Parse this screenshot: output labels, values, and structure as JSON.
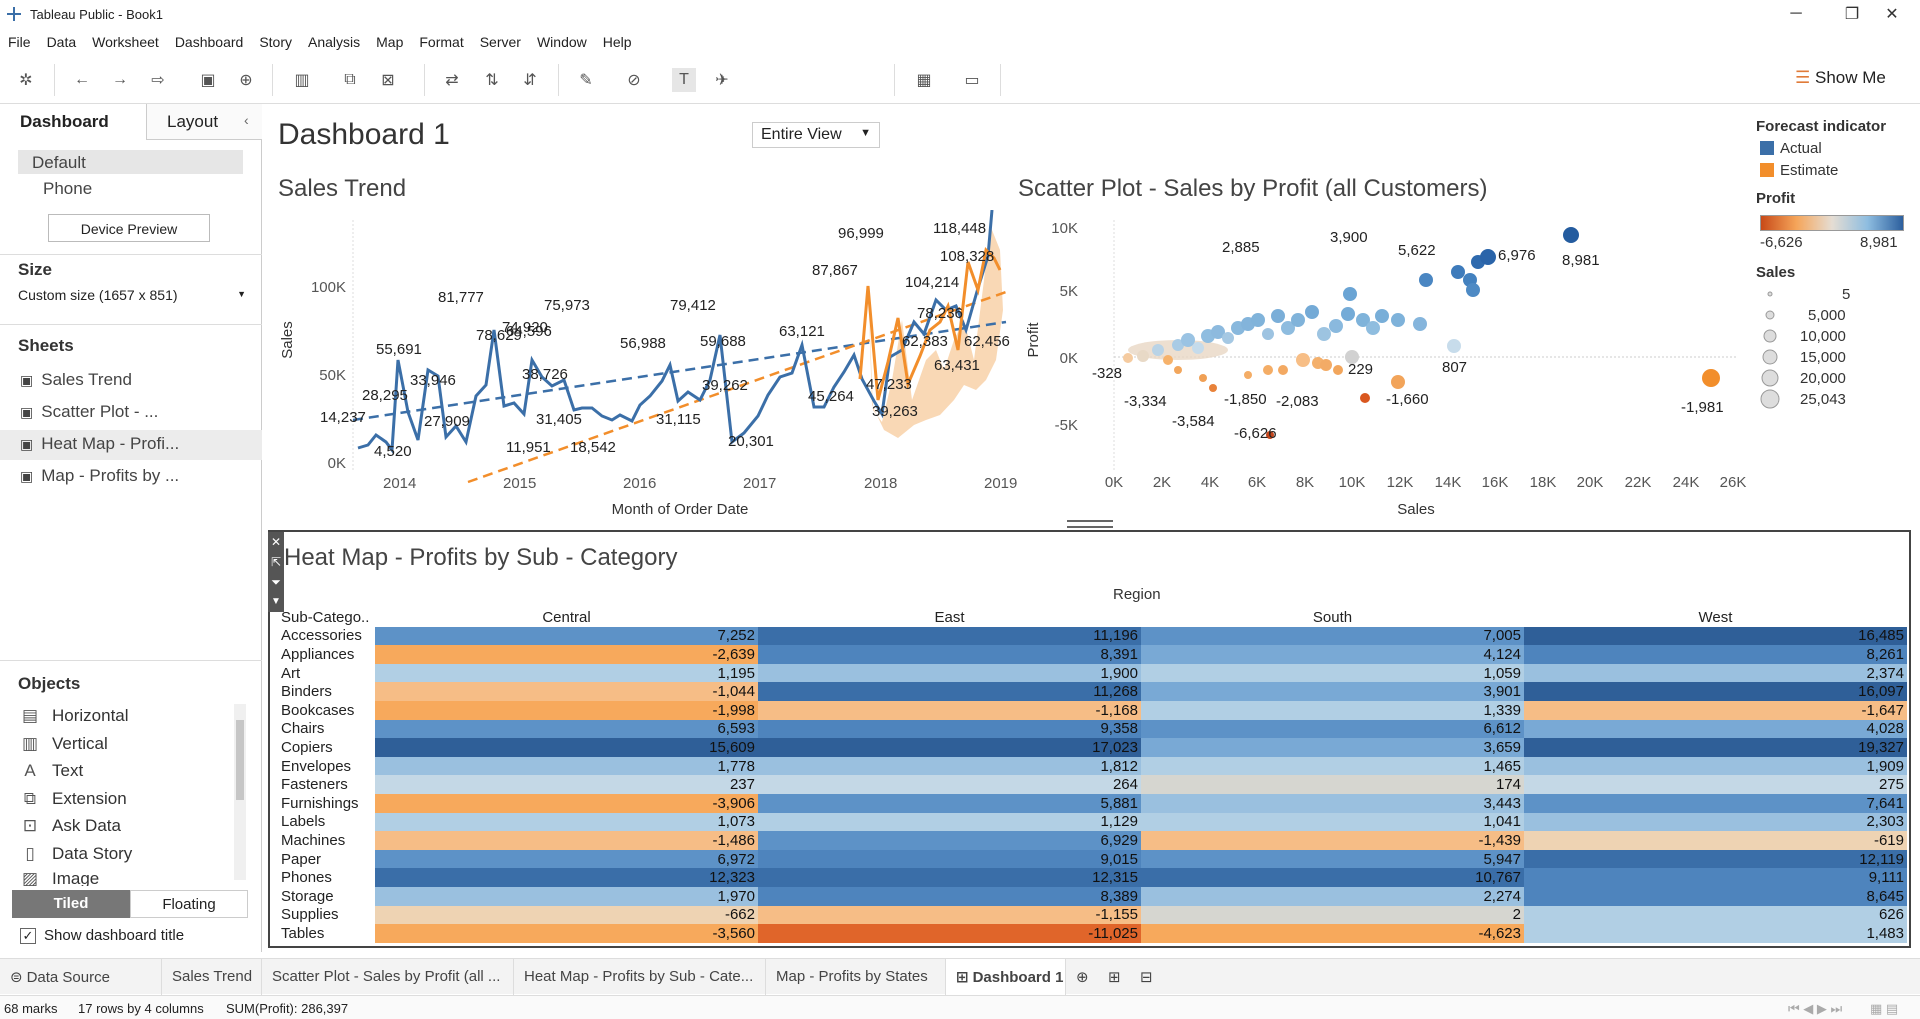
{
  "window": {
    "title": "Tableau Public - Book1"
  },
  "menu": [
    "File",
    "Data",
    "Worksheet",
    "Dashboard",
    "Story",
    "Analysis",
    "Map",
    "Format",
    "Server",
    "Window",
    "Help"
  ],
  "toolbar": {
    "view_select": "Entire View",
    "show_me": "Show Me"
  },
  "left_panel": {
    "tab_dashboard": "Dashboard",
    "tab_layout": "Layout",
    "device_default": "Default",
    "device_phone": "Phone",
    "device_preview_button": "Device Preview",
    "size_title": "Size",
    "size_value": "Custom size (1657 x 851)",
    "sheets_title": "Sheets",
    "sheets": [
      "Sales Trend",
      "Scatter Plot - ...",
      "Heat Map - Profi...",
      "Map - Profits by ..."
    ],
    "objects_title": "Objects",
    "objects": [
      "Horizontal",
      "Vertical",
      "Text",
      "Extension",
      "Ask Data",
      "Data Story",
      "Image"
    ],
    "tiled_button": "Tiled",
    "floating_button": "Floating",
    "show_title_label": "Show dashboard title"
  },
  "dashboard": {
    "title": "Dashboard 1"
  },
  "sales_trend": {
    "title": "Sales Trend",
    "xlabel": "Month of Order Date",
    "ylabel": "Sales",
    "yticks": [
      "100K",
      "50K",
      "0K"
    ],
    "xticks": [
      "2014",
      "2015",
      "2016",
      "2017",
      "2018",
      "2019"
    ],
    "labels": [
      "118,448",
      "96,999",
      "87,867",
      "81,777",
      "79,412",
      "78,629",
      "75,973",
      "74,920",
      "64,596",
      "63,121",
      "59,688",
      "56,988",
      "55,691",
      "45,264",
      "39,262",
      "38,726",
      "33,946",
      "31,405",
      "31,115",
      "28,295",
      "27,909",
      "20,301",
      "18,542",
      "14,237",
      "11,951",
      "4,520",
      "104,214",
      "108,328",
      "78,236",
      "62,383",
      "62,456",
      "63,431",
      "47,233",
      "39,263"
    ]
  },
  "scatter": {
    "title": "Scatter Plot - Sales by Profit (all Customers)",
    "xlabel": "Sales",
    "ylabel": "Profit",
    "yticks": [
      "10K",
      "5K",
      "0K",
      "-5K"
    ],
    "xticks": [
      "0K",
      "2K",
      "4K",
      "6K",
      "8K",
      "10K",
      "12K",
      "14K",
      "16K",
      "18K",
      "20K",
      "22K",
      "24K",
      "26K"
    ],
    "labels": [
      "8,981",
      "6,976",
      "5,622",
      "3,900",
      "2,885",
      "229",
      "807",
      "-328",
      "-3,334",
      "-3,584",
      "-1,850",
      "-2,083",
      "-6,626",
      "-1,660",
      "-1,981"
    ]
  },
  "legend": {
    "forecast_title": "Forecast indicator",
    "actual": "Actual",
    "estimate": "Estimate",
    "profit_title": "Profit",
    "profit_min": "-6,626",
    "profit_max": "8,981",
    "sales_title": "Sales",
    "sales_sizes": [
      "5",
      "5,000",
      "10,000",
      "15,000",
      "20,000",
      "25,043"
    ]
  },
  "heatmap": {
    "title": "Heat Map - Profits by Sub - Category",
    "region_label": "Region",
    "subcat_header": "Sub-Catego..",
    "regions": [
      "Central",
      "East",
      "South",
      "West"
    ],
    "rows": [
      {
        "name": "Accessories",
        "values": [
          "7,252",
          "11,196",
          "7,005",
          "16,485"
        ]
      },
      {
        "name": "Appliances",
        "values": [
          "-2,639",
          "8,391",
          "4,124",
          "8,261"
        ]
      },
      {
        "name": "Art",
        "values": [
          "1,195",
          "1,900",
          "1,059",
          "2,374"
        ]
      },
      {
        "name": "Binders",
        "values": [
          "-1,044",
          "11,268",
          "3,901",
          "16,097"
        ]
      },
      {
        "name": "Bookcases",
        "values": [
          "-1,998",
          "-1,168",
          "1,339",
          "-1,647"
        ]
      },
      {
        "name": "Chairs",
        "values": [
          "6,593",
          "9,358",
          "6,612",
          "4,028"
        ]
      },
      {
        "name": "Copiers",
        "values": [
          "15,609",
          "17,023",
          "3,659",
          "19,327"
        ]
      },
      {
        "name": "Envelopes",
        "values": [
          "1,778",
          "1,812",
          "1,465",
          "1,909"
        ]
      },
      {
        "name": "Fasteners",
        "values": [
          "237",
          "264",
          "174",
          "275"
        ]
      },
      {
        "name": "Furnishings",
        "values": [
          "-3,906",
          "5,881",
          "3,443",
          "7,641"
        ]
      },
      {
        "name": "Labels",
        "values": [
          "1,073",
          "1,129",
          "1,041",
          "2,303"
        ]
      },
      {
        "name": "Machines",
        "values": [
          "-1,486",
          "6,929",
          "-1,439",
          "-619"
        ]
      },
      {
        "name": "Paper",
        "values": [
          "6,972",
          "9,015",
          "5,947",
          "12,119"
        ]
      },
      {
        "name": "Phones",
        "values": [
          "12,323",
          "12,315",
          "10,767",
          "9,111"
        ]
      },
      {
        "name": "Storage",
        "values": [
          "1,970",
          "8,389",
          "2,274",
          "8,645"
        ]
      },
      {
        "name": "Supplies",
        "values": [
          "-662",
          "-1,155",
          "2",
          "626"
        ]
      },
      {
        "name": "Tables",
        "values": [
          "-3,560",
          "-11,025",
          "-4,623",
          "1,483"
        ]
      }
    ]
  },
  "bottom_tabs": [
    "Data Source",
    "Sales Trend",
    "Scatter Plot - Sales by Profit (all ...",
    "Heat Map - Profits by Sub - Cate...",
    "Map - Profits by States",
    "Dashboard 1"
  ],
  "status": {
    "marks": "68 marks",
    "rows": "17 rows by 4 columns",
    "sum": "SUM(Profit): 286,397"
  }
}
